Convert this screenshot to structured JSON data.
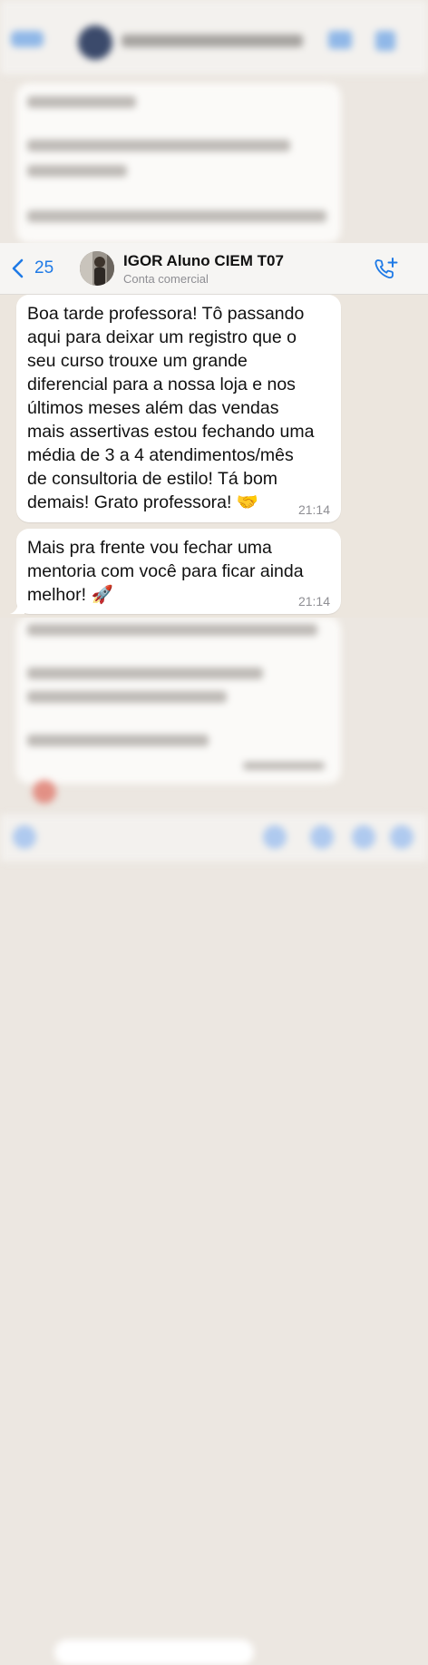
{
  "header": {
    "back_count": "25",
    "contact_name": "IGOR Aluno CIEM T07",
    "contact_subtitle": "Conta comercial"
  },
  "messages": [
    {
      "text": "Boa tarde professora! Tô passando\naqui para deixar um registro que o\nseu curso trouxe um grande\ndiferencial para a nossa loja e nos\núltimos meses além das vendas\nmais assertivas estou fechando uma\nmédia de 3 a 4 atendimentos/mês\nde consultoria de estilo! Tá bom\ndemais! Grato professora! 🤝",
      "time": "21:14"
    },
    {
      "text": "Mais pra frente vou fechar uma\nmentoria com você para ficar ainda\nmelhor! 🚀",
      "time": "21:14"
    }
  ],
  "colors": {
    "accent": "#1f7ae6",
    "bubble": "#ffffff",
    "chat_background": "#ece6de",
    "time_text": "#8e8e93"
  },
  "icons": [
    "chevron-left-icon",
    "contact-avatar",
    "phone-plus-icon"
  ]
}
